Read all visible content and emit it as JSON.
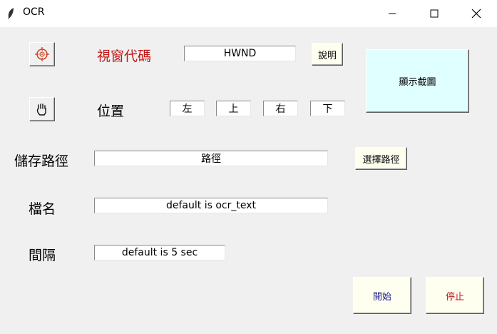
{
  "window": {
    "title": "OCR",
    "icons": {
      "app": "feather-icon",
      "minimize": "minimize-icon",
      "maximize": "maximize-icon",
      "close": "close-icon"
    }
  },
  "colors": {
    "label_red": "#c01818",
    "button_cream": "#fffff0",
    "button_cyan": "#e0ffff",
    "start_text": "#1a1a8c",
    "stop_text": "#c01818"
  },
  "form": {
    "target_icon": "crosshair-icon",
    "hand_icon": "hand-grab-icon",
    "hwnd_label": "視窗代碼",
    "hwnd_value": "HWND",
    "help_button": "說明",
    "screenshot_button": "顯示截圖",
    "position_label": "位置",
    "left_value": "左",
    "top_value": "上",
    "right_value": "右",
    "bottom_value": "下",
    "path_label": "儲存路徑",
    "path_value": "路徑",
    "choose_path_button": "選擇路徑",
    "filename_label": "檔名",
    "filename_value": "default is ocr_text",
    "interval_label": "間隔",
    "interval_value": "default is 5 sec",
    "start_button": "開始",
    "stop_button": "停止"
  }
}
